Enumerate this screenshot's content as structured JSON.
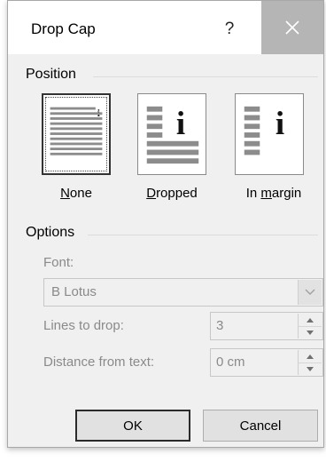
{
  "window": {
    "title": "Drop Cap",
    "help_label": "?"
  },
  "position": {
    "section_label": "Position",
    "options": [
      {
        "label_mnemonic": "N",
        "label_rest": "one",
        "selected": true
      },
      {
        "label_mnemonic": "D",
        "label_rest": "ropped",
        "selected": false
      },
      {
        "label_prefix": "In ",
        "label_mnemonic": "m",
        "label_rest": "argin",
        "selected": false
      }
    ]
  },
  "options_section": {
    "section_label": "Options",
    "font_label": "Font:",
    "font_value": "B Lotus",
    "lines_label": "Lines to drop:",
    "lines_value": "3",
    "distance_label": "Distance from text:",
    "distance_value": "0 cm"
  },
  "buttons": {
    "ok_label": "OK",
    "cancel_label": "Cancel"
  },
  "colors": {
    "titlebar_bg": "#ffffff",
    "close_hover_bg": "#b5b5b5",
    "dialog_bg": "#f0f0f0",
    "disabled_text": "#8a8a8a"
  }
}
